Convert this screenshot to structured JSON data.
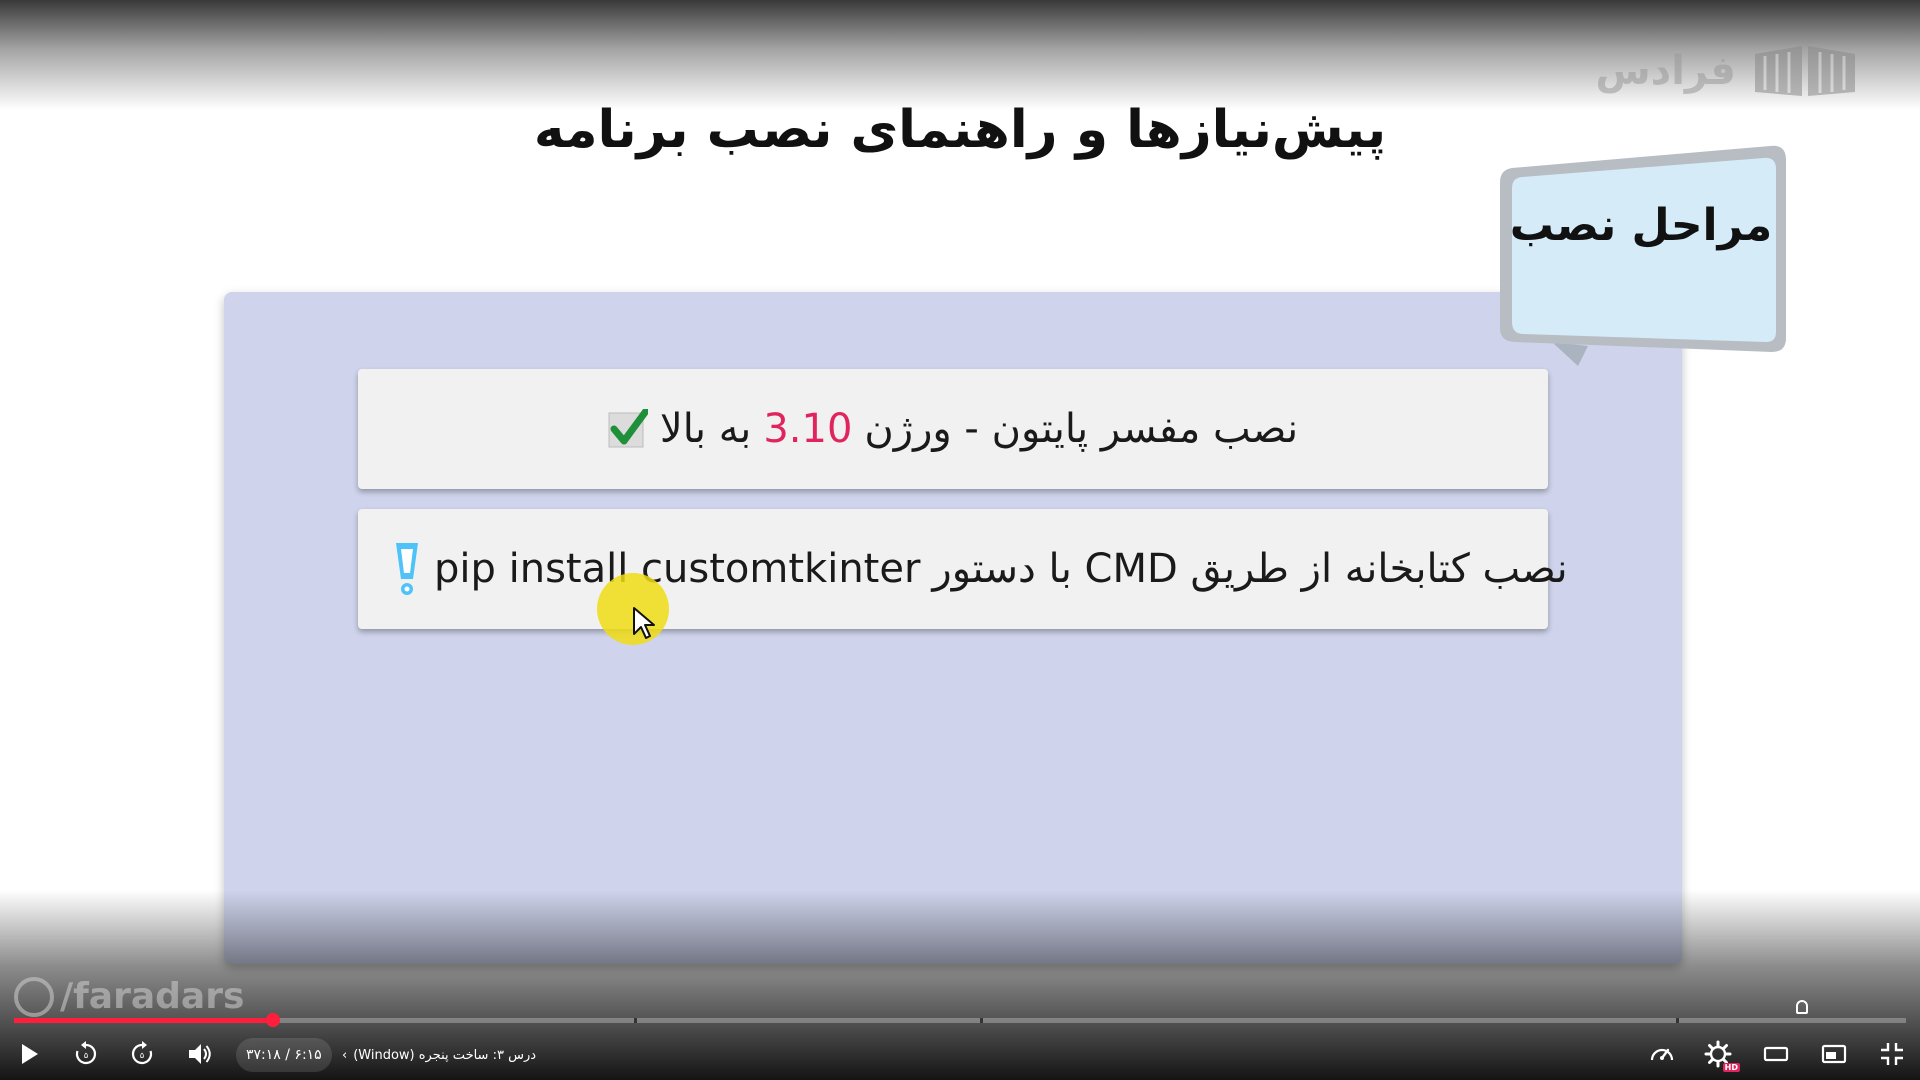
{
  "brand": {
    "logo_text": "فرادس",
    "watermark": "/faradars"
  },
  "slide": {
    "title": "پیش‌نیازها و راهنمای نصب برنامه",
    "callout": "مراحل نصب",
    "step1": {
      "text_before": "نصب مفسر پایتون - ورژن",
      "version": "3.10",
      "text_after": "به بالا",
      "status_icon": "check-icon"
    },
    "step2": {
      "text": "نصب کتابخانه از طریق CMD با دستور",
      "command": "pip install customtkinter",
      "status_icon": "exclamation-icon"
    }
  },
  "player": {
    "time": "۶:۱۵ / ۳۷:۱۸",
    "chapter": "درس ۳: ساخت پنجره (Window)",
    "progress_played": 0.137,
    "progress_buffered": 0.138,
    "colors": {
      "progress": "#ff1f3d",
      "accent": "#e0245e"
    },
    "controls": {
      "play": "play-icon",
      "rewind": "rewind-10-icon",
      "forward": "forward-10-icon",
      "volume": "volume-icon",
      "speed": "speed-icon",
      "settings": "settings-hd-icon",
      "hd_badge": "HD",
      "theater": "theater-mode-icon",
      "miniplayer": "miniplayer-icon",
      "fullscreen_exit": "exit-fullscreen-icon"
    }
  }
}
